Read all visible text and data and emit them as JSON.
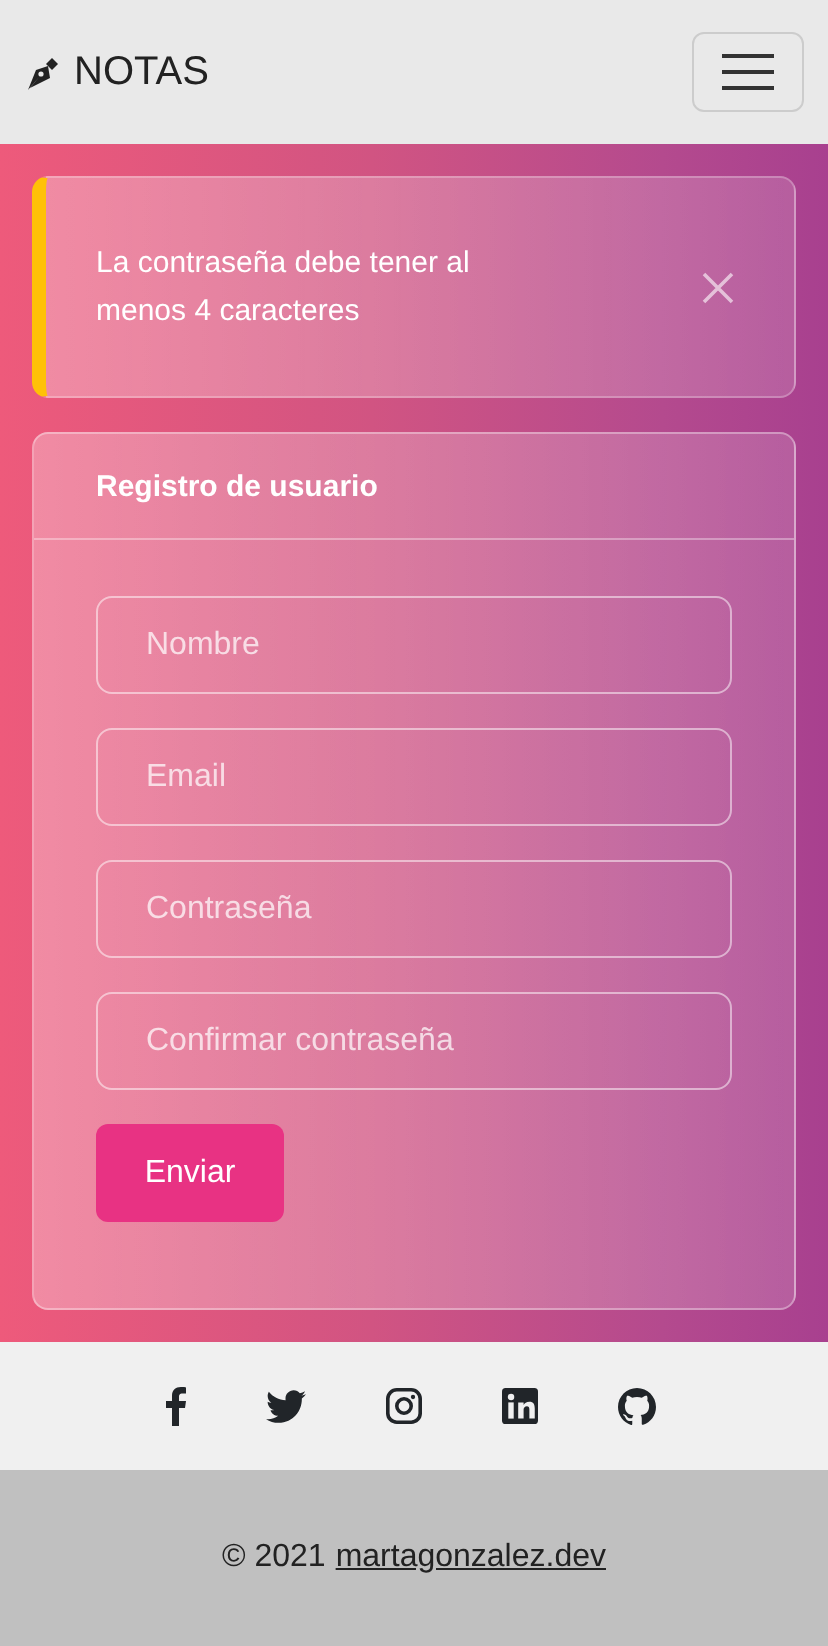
{
  "navbar": {
    "brand": "NOTAS"
  },
  "alert": {
    "message": "La contraseña debe tener al menos 4 caracteres"
  },
  "form": {
    "title": "Registro de usuario",
    "fields": [
      {
        "placeholder": "Nombre"
      },
      {
        "placeholder": "Email"
      },
      {
        "placeholder": "Contraseña"
      },
      {
        "placeholder": "Confirmar contraseña"
      }
    ],
    "submit": "Enviar"
  },
  "footer": {
    "copyright": "© 2021",
    "link": "martagonzalez.dev"
  }
}
